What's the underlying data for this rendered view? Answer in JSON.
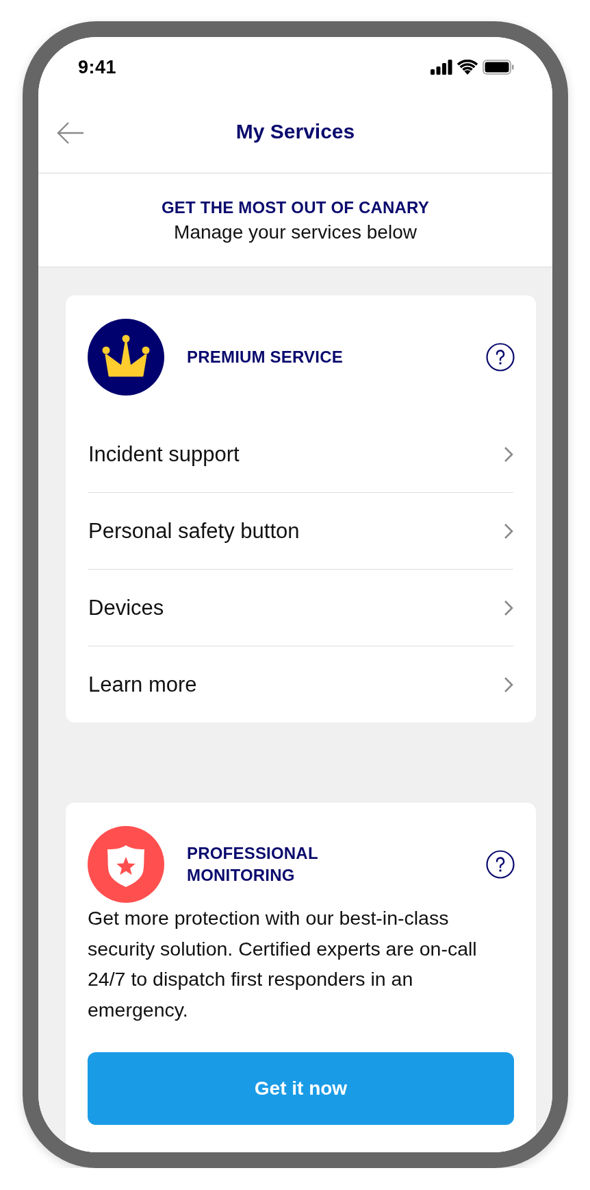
{
  "status_bar": {
    "time": "9:41"
  },
  "nav": {
    "title": "My Services"
  },
  "header": {
    "title": "GET THE MOST OUT OF CANARY",
    "subtitle": "Manage your services below"
  },
  "services": [
    {
      "kind": "links",
      "title": "PREMIUM SERVICE",
      "items": [
        "Incident support",
        "Personal safety button",
        "Devices",
        "Learn more"
      ]
    },
    {
      "kind": "promo",
      "title": "PROFESSIONAL MONITORING",
      "description": "Get more protection with our best-in-class security solution. Certified experts are on-call 24/7 to dispatch first responders in an emergency.",
      "button": "Get it now"
    }
  ]
}
